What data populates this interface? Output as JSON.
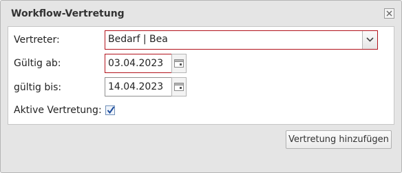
{
  "dialog": {
    "title": "Workflow-Vertretung"
  },
  "form": {
    "vertreter": {
      "label": "Vertreter:",
      "value": "Bedarf | Bea"
    },
    "gueltig_ab": {
      "label": "Gültig ab:",
      "value": "03.04.2023"
    },
    "gueltig_bis": {
      "label": "gültig bis:",
      "value": "14.04.2023"
    },
    "aktive_vertretung": {
      "label": "Aktive Vertretung:",
      "checked": true
    }
  },
  "footer": {
    "add_button_label": "Vertretung hinzufügen"
  },
  "colors": {
    "invalid_border": "#b1121b",
    "checkmark": "#1c4c9c"
  }
}
